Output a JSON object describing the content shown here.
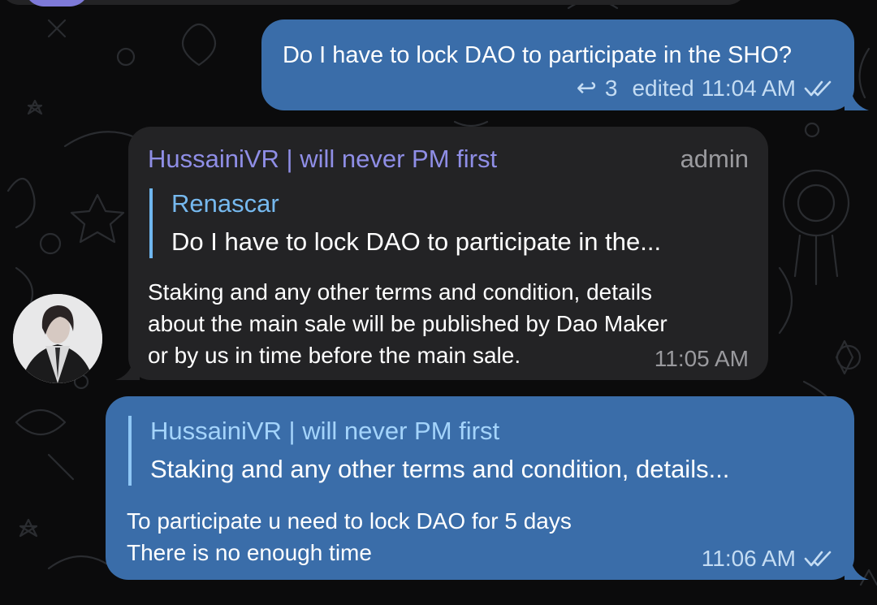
{
  "colors": {
    "background": "#0b0b0c",
    "outgoing_bubble": "#3a6da9",
    "incoming_bubble": "#232325",
    "sender_name": "#8f8ee6",
    "quote_accent": "#6fb6ef",
    "meta_text": "#c4dcf3"
  },
  "messages": [
    {
      "direction": "outgoing",
      "text": "Do I have to lock DAO to participate in the SHO?",
      "replies_count": "3",
      "edited_label": "edited",
      "time": "11:04 AM",
      "status_icon": "double-check-icon"
    },
    {
      "direction": "incoming",
      "sender": "HussainiVR | will never PM first",
      "role": "admin",
      "reply_to": {
        "name": "Renascar",
        "text": "Do I have to lock DAO to participate in the..."
      },
      "lines": [
        "Staking and any other terms and condition, details",
        "about the main sale will be published by Dao Maker",
        "or by us in time before the main sale."
      ],
      "time": "11:05 AM"
    },
    {
      "direction": "outgoing",
      "reply_to": {
        "name": "HussainiVR | will never PM first",
        "text": "Staking and any other terms and condition, details..."
      },
      "lines": [
        "To participate u need to lock DAO for 5 days",
        "There is no enough time"
      ],
      "time": "11:06 AM",
      "status_icon": "double-check-icon"
    }
  ]
}
